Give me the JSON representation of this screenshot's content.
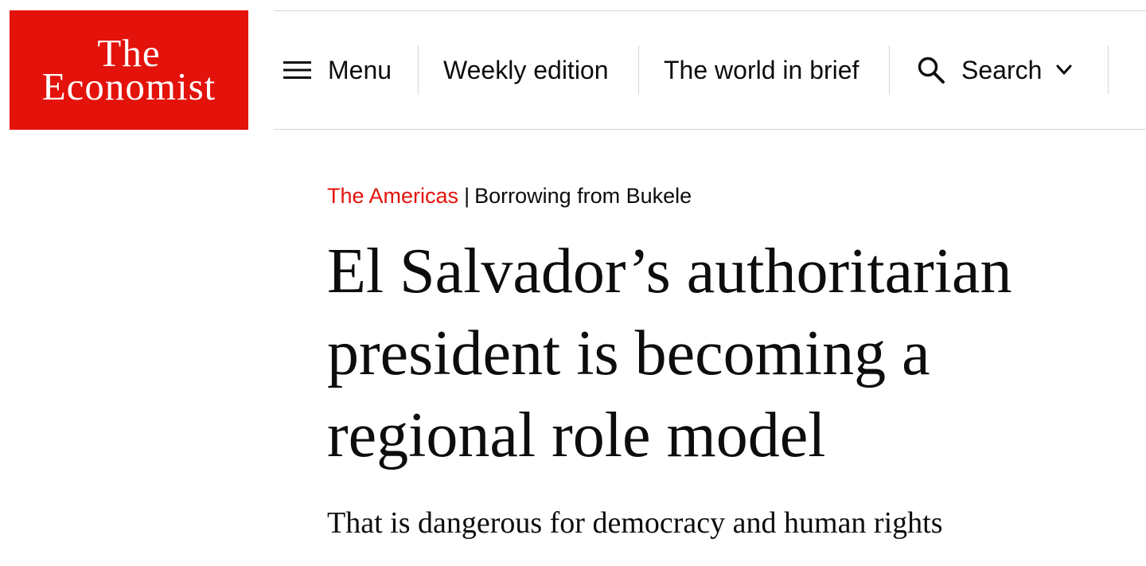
{
  "logo": {
    "line1": "The",
    "line2": "Economist"
  },
  "nav": {
    "menu": {
      "label": "Menu",
      "icon": "hamburger-menu-icon"
    },
    "weekly": {
      "label": "Weekly edition"
    },
    "brief": {
      "label": "The world in brief"
    },
    "search": {
      "label": "Search",
      "icon": "search-icon",
      "dropdown_icon": "chevron-down-icon"
    }
  },
  "article": {
    "section": "The Americas",
    "separator": "|",
    "flytitle": "Borrowing from Bukele",
    "headline": "El Salvador’s authoritarian president is becoming a regional role model",
    "subheadline": "That is dangerous for democracy and human rights"
  },
  "colors": {
    "brand_red": "#e3120b",
    "text": "#0d0d0d",
    "divider": "#d6d6d6",
    "background": "#ffffff"
  }
}
